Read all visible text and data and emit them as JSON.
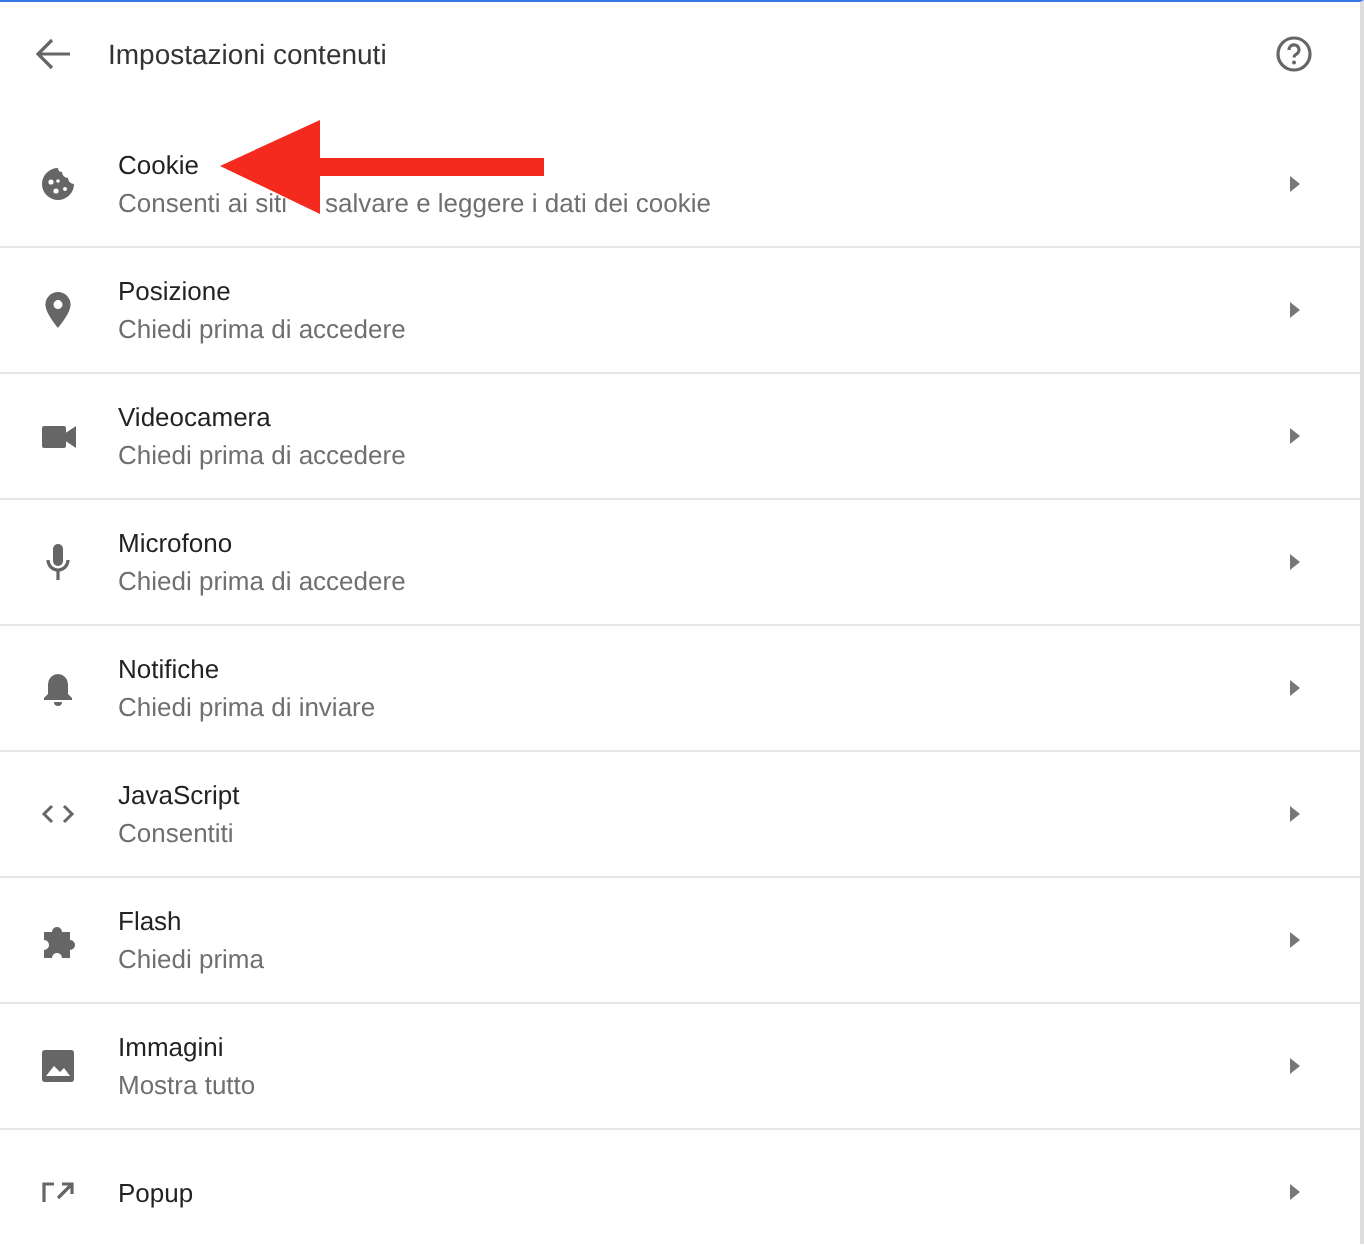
{
  "header": {
    "title": "Impostazioni contenuti"
  },
  "items": [
    {
      "kind": "cookie",
      "title": "Cookie",
      "description_parts": [
        "Consenti ai siti",
        "salvare e leggere i dati dei cookie"
      ]
    },
    {
      "kind": "location",
      "title": "Posizione",
      "description_parts": [
        "Chiedi prima di accedere"
      ]
    },
    {
      "kind": "camera",
      "title": "Videocamera",
      "description_parts": [
        "Chiedi prima di accedere"
      ]
    },
    {
      "kind": "mic",
      "title": "Microfono",
      "description_parts": [
        "Chiedi prima di accedere"
      ]
    },
    {
      "kind": "bell",
      "title": "Notifiche",
      "description_parts": [
        "Chiedi prima di inviare"
      ]
    },
    {
      "kind": "code",
      "title": "JavaScript",
      "description_parts": [
        "Consentiti"
      ]
    },
    {
      "kind": "puzzle",
      "title": "Flash",
      "description_parts": [
        "Chiedi prima"
      ]
    },
    {
      "kind": "image",
      "title": "Immagini",
      "description_parts": [
        "Mostra tutto"
      ]
    },
    {
      "kind": "popup",
      "title": "Popup"
    }
  ]
}
